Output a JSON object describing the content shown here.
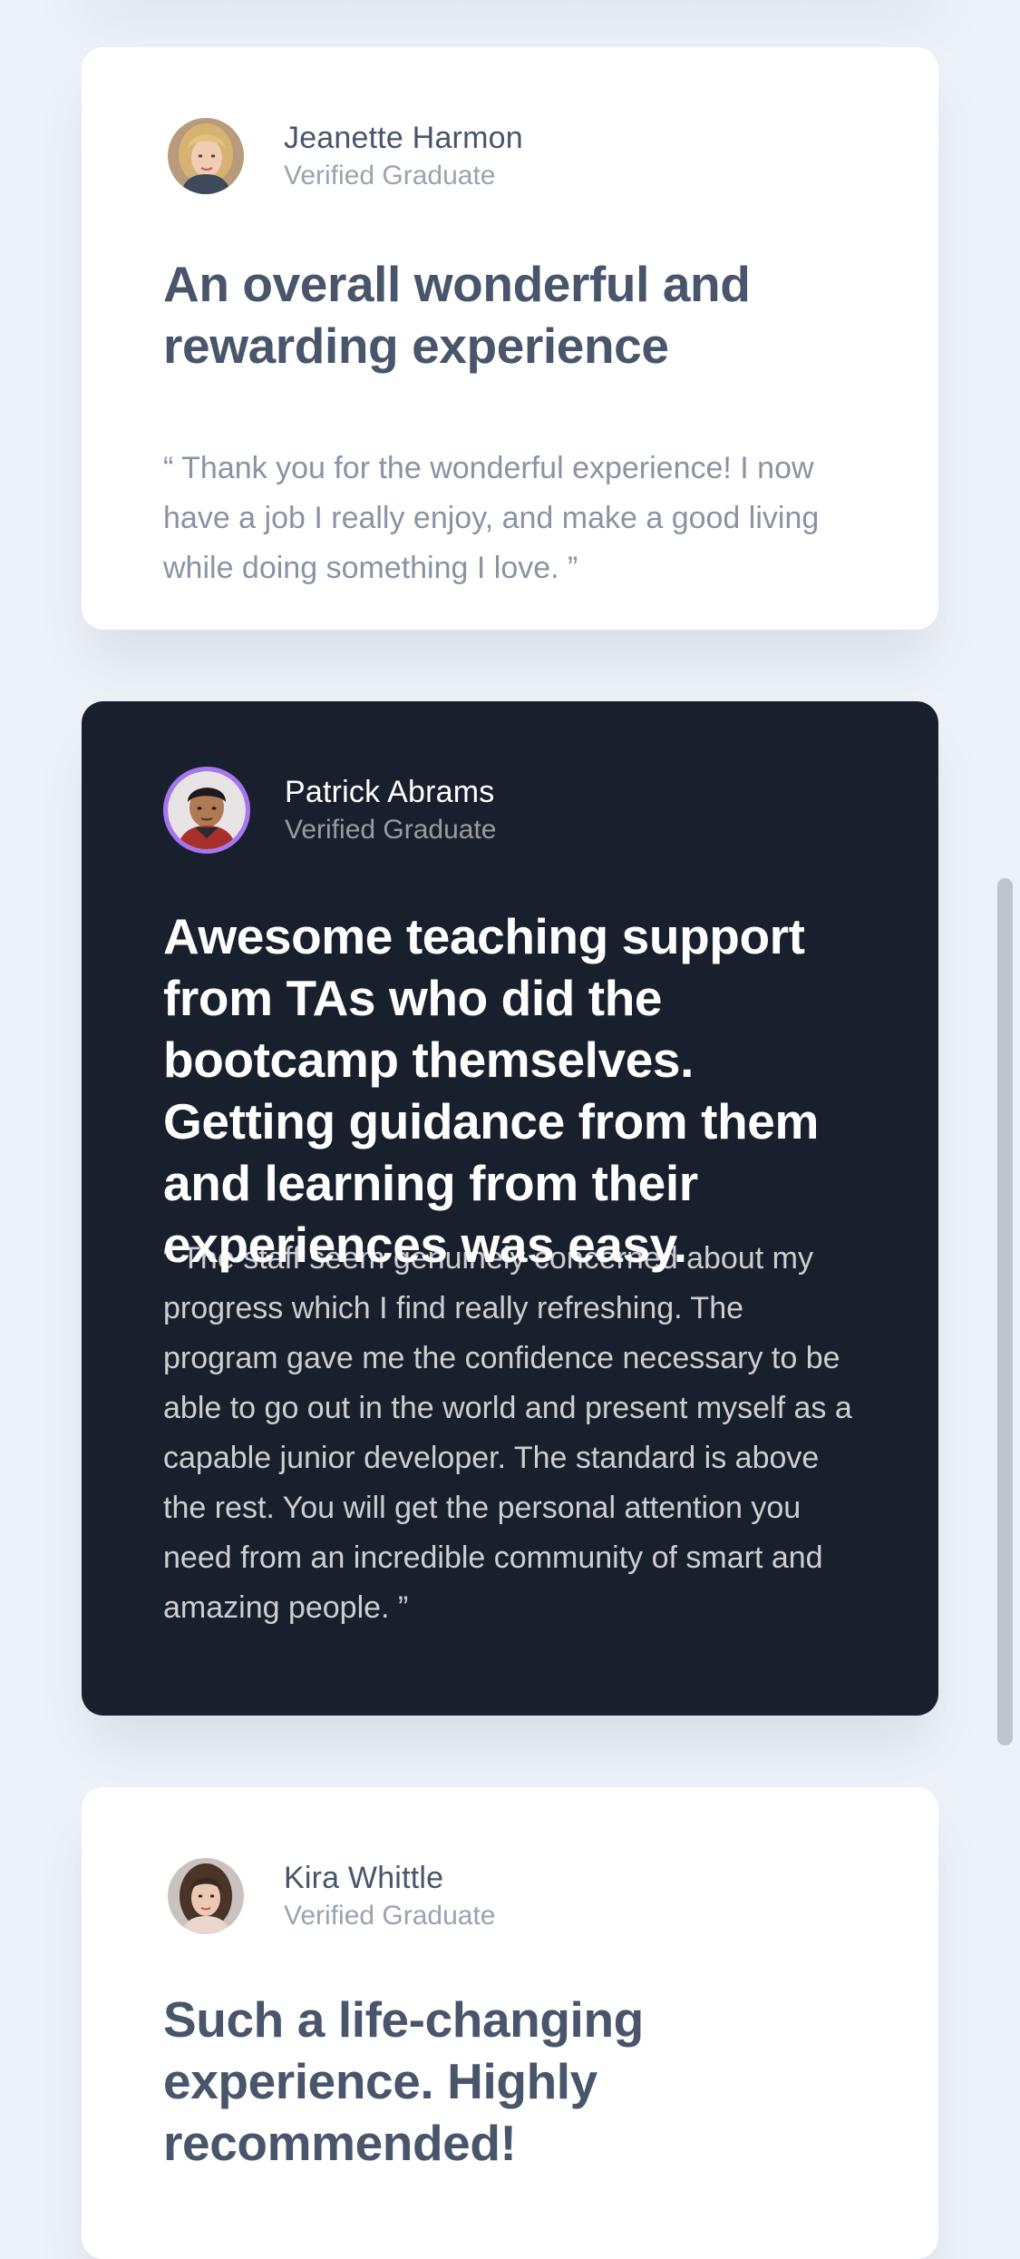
{
  "testimonials": [
    {
      "name": "Jeanette Harmon",
      "role": "Verified Graduate",
      "avatar_icon": "avatar-photo-jeanette",
      "headline": "An overall wonderful and rewarding experience",
      "quote": "“ Thank you for the wonderful experience! I now have a job I really enjoy, and make a good living while doing something I love. ”",
      "theme": "light"
    },
    {
      "name": "Patrick Abrams",
      "role": "Verified Graduate",
      "avatar_icon": "avatar-photo-patrick",
      "headline": "Awesome teaching support from TAs who did the bootcamp themselves. Getting guidance from them and learning from their experiences was easy.",
      "quote": "“ The staff seem genuinely concerned about my progress which I find really refreshing. The program gave me the confidence necessary to be able to go out in the world and present myself as a capable junior developer. The standard is above the rest. You will get the personal attention you need from an incredible community of smart and amazing people. ”",
      "theme": "dark",
      "avatar_ring_color": "#A775F1"
    },
    {
      "name": "Kira Whittle",
      "role": "Verified Graduate",
      "avatar_icon": "avatar-photo-kira",
      "headline": "Such a life-changing experience. Highly recommended!",
      "theme": "light"
    }
  ],
  "colors": {
    "page_background": "#ECF2F8",
    "card_light": "#FFFFFF",
    "card_dark": "#19202D",
    "text_dark": "#48556A",
    "text_muted": "#9AA3B0",
    "accent": "#A775F1"
  }
}
